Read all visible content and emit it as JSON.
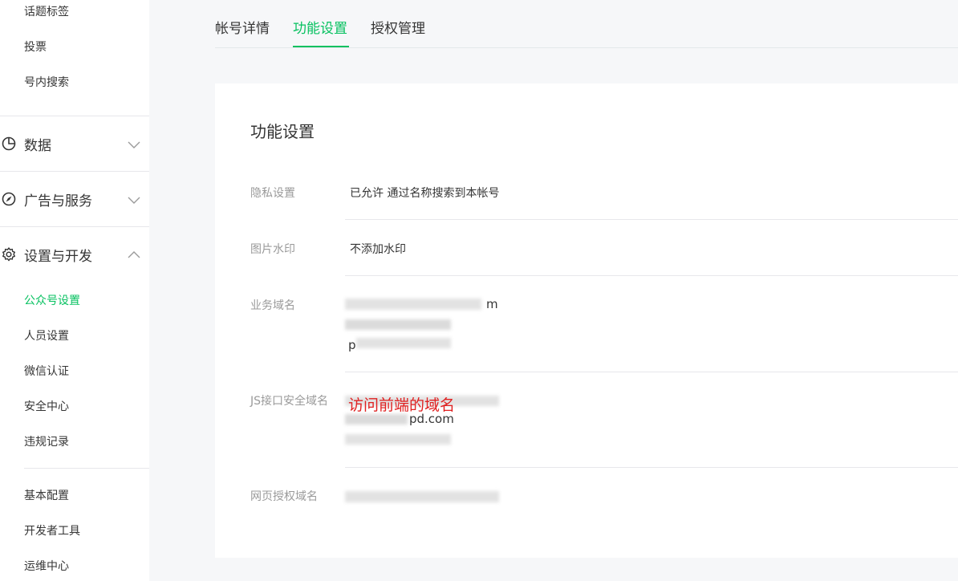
{
  "sidebar": {
    "top_items": [
      {
        "label": "话题标签"
      },
      {
        "label": "投票"
      },
      {
        "label": "号内搜索"
      }
    ],
    "groups": [
      {
        "label": "数据",
        "icon": "pie-chart-icon",
        "expanded": false
      },
      {
        "label": "广告与服务",
        "icon": "compass-icon",
        "expanded": false
      },
      {
        "label": "设置与开发",
        "icon": "gear-icon",
        "expanded": true
      }
    ],
    "settings_items": [
      {
        "label": "公众号设置",
        "active": true
      },
      {
        "label": "人员设置"
      },
      {
        "label": "微信认证"
      },
      {
        "label": "安全中心"
      },
      {
        "label": "违规记录"
      }
    ],
    "dev_items": [
      {
        "label": "基本配置"
      },
      {
        "label": "开发者工具"
      },
      {
        "label": "运维中心"
      }
    ]
  },
  "tabs": [
    {
      "label": "帐号详情"
    },
    {
      "label": "功能设置",
      "active": true
    },
    {
      "label": "授权管理"
    }
  ],
  "card": {
    "title": "功能设置",
    "rows": [
      {
        "label": "隐私设置",
        "value": "已允许 通过名称搜索到本帐号"
      },
      {
        "label": "图片水印",
        "value": "不添加水印"
      },
      {
        "label": "业务域名",
        "visible_fragments": [
          "m",
          "p"
        ]
      },
      {
        "label": "JS接口安全域名",
        "visible_fragments": [
          "pd.com"
        ]
      },
      {
        "label": "网页授权域名"
      }
    ],
    "annotation": "访问前端的域名"
  },
  "colors": {
    "accent": "#07c160",
    "annotation": "#e02020",
    "label_gray": "#9a9a9a",
    "text": "#353535",
    "background": "#f6f7f9"
  }
}
